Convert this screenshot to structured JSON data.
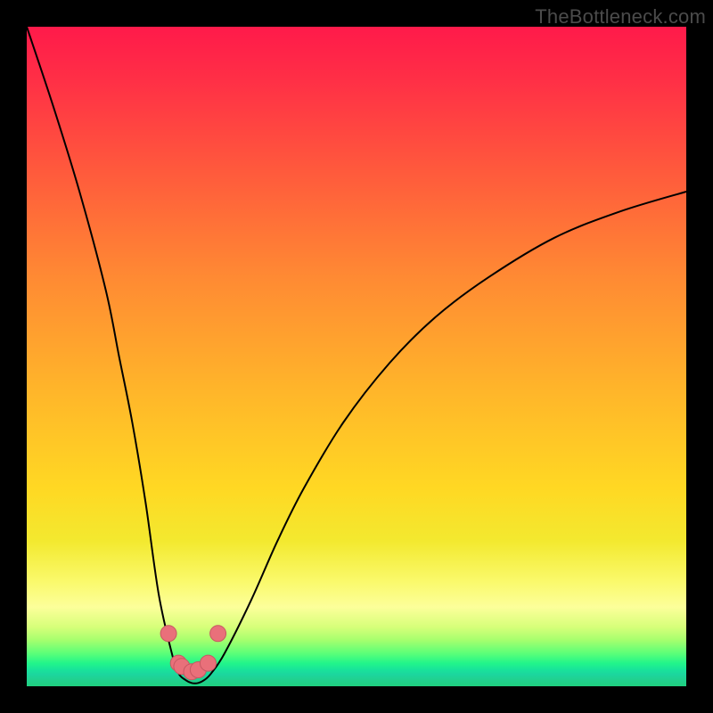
{
  "watermark": "TheBottleneck.com",
  "chart_data": {
    "type": "line",
    "title": "",
    "xlabel": "",
    "ylabel": "",
    "xlim": [
      0,
      100
    ],
    "ylim": [
      0,
      100
    ],
    "series": [
      {
        "name": "bottleneck-curve",
        "x": [
          0,
          4,
          8,
          12,
          14,
          16,
          18,
          20,
          22,
          23,
          24,
          25,
          26,
          27,
          28,
          30,
          34,
          38,
          42,
          48,
          55,
          62,
          70,
          80,
          90,
          100
        ],
        "values": [
          100,
          88,
          75,
          60,
          50,
          40,
          28,
          14,
          5,
          2,
          1,
          0.5,
          0.5,
          1,
          2,
          5,
          13,
          22,
          30,
          40,
          49,
          56,
          62,
          68,
          72,
          75
        ]
      }
    ],
    "markers": {
      "x": [
        21.5,
        23.0,
        23.5,
        25.0,
        26.0,
        27.5,
        29.0
      ],
      "values": [
        8.0,
        3.5,
        3.0,
        2.2,
        2.5,
        3.5,
        8.0
      ],
      "color": "#e9707a",
      "stroke": "#c65862",
      "radius": 9
    },
    "curve_color": "#000000",
    "curve_width": 2
  }
}
